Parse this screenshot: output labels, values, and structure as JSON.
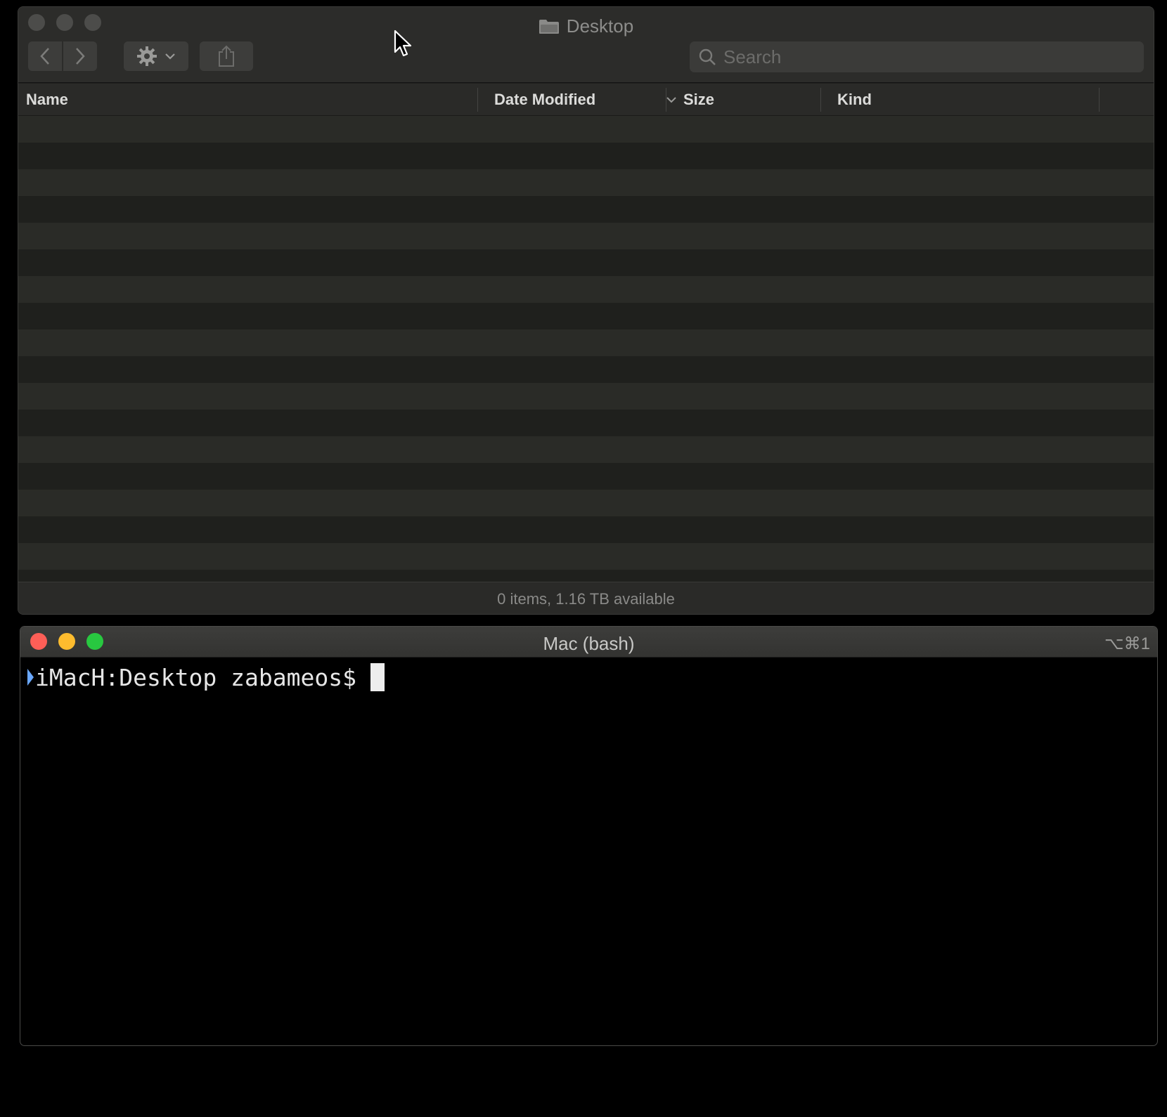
{
  "finder": {
    "title": "Desktop",
    "search": {
      "placeholder": "Search",
      "value": ""
    },
    "columns": {
      "name": "Name",
      "date_modified": "Date Modified",
      "size": "Size",
      "kind": "Kind"
    },
    "status": "0 items, 1.16 TB available"
  },
  "terminal": {
    "title": "Mac (bash)",
    "shortcut": "⌥⌘1",
    "prompt": "iMacH:Desktop zabameos$"
  },
  "colors": {
    "close": "#fe5f57",
    "minimize": "#febc2e",
    "maximize": "#28c840",
    "prompt_marker": "#6aa8ff"
  }
}
